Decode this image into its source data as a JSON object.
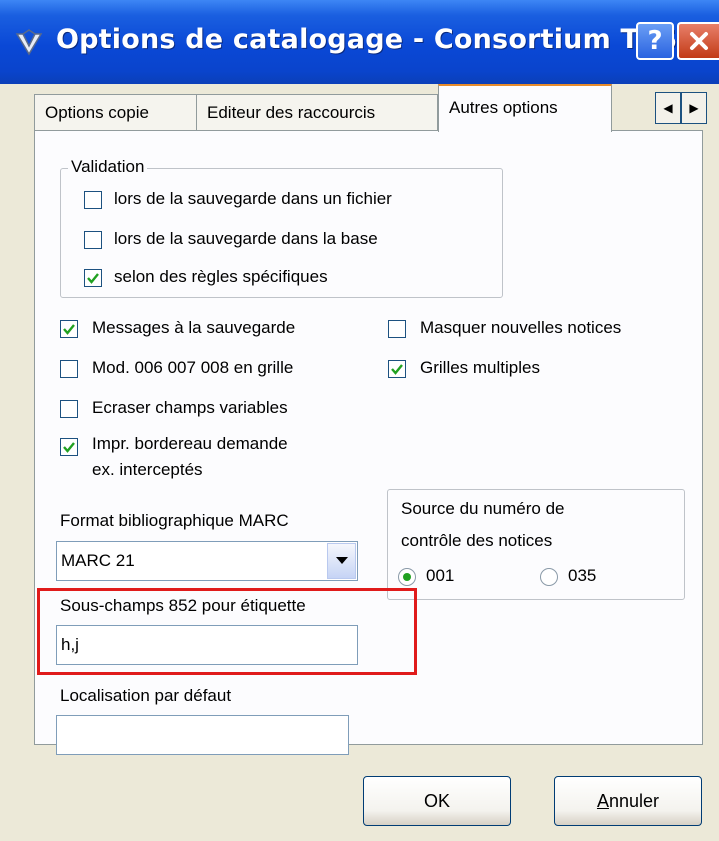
{
  "window": {
    "title": "Options de catalogage - Consortium TEST",
    "help_label": "?",
    "close_label": "✕"
  },
  "tabs": [
    {
      "label": "Options copie",
      "selected": false
    },
    {
      "label": "Editeur des raccourcis",
      "selected": false
    },
    {
      "label": "Autres options",
      "selected": true
    }
  ],
  "tab_scroll": {
    "prev": "◀",
    "next": "▶"
  },
  "validation": {
    "legend": "Validation",
    "options": [
      {
        "label": "lors de la sauvegarde dans un fichier",
        "checked": false
      },
      {
        "label": "lors de la sauvegarde dans la base",
        "checked": false
      },
      {
        "label": "selon des règles spécifiques",
        "checked": true
      }
    ]
  },
  "options": {
    "messages_sauvegarde": {
      "label": "Messages à la sauvegarde",
      "checked": true
    },
    "masquer_notices": {
      "label": "Masquer nouvelles notices",
      "checked": false
    },
    "mod_grille": {
      "label": "Mod. 006 007 008 en grille",
      "checked": false
    },
    "grilles_multiples": {
      "label": "Grilles multiples",
      "checked": true
    },
    "ecraser_champs": {
      "label": "Ecraser champs variables",
      "checked": false
    },
    "impr_bordereau": {
      "label_line1": "Impr. bordereau demande",
      "label_line2": "ex. interceptés",
      "checked": true
    }
  },
  "format_marc": {
    "label": "Format bibliographique MARC",
    "selected": "MARC 21"
  },
  "source_controle": {
    "legend_line1": "Source du numéro de",
    "legend_line2": "contrôle des notices",
    "radios": [
      {
        "label": "001",
        "selected": true
      },
      {
        "label": "035",
        "selected": false
      }
    ]
  },
  "sous_champs": {
    "label": "Sous-champs 852 pour étiquette",
    "value": "h,j"
  },
  "localisation": {
    "label": "Localisation par défaut",
    "value": ""
  },
  "buttons": {
    "ok": "OK",
    "cancel_first": "A",
    "cancel_rest": "nnuler"
  },
  "colors": {
    "titlebar": "#0a48d6",
    "highlight": "#e01b1b",
    "tab_active_accent": "#e68b2c",
    "check": "#21a121"
  }
}
